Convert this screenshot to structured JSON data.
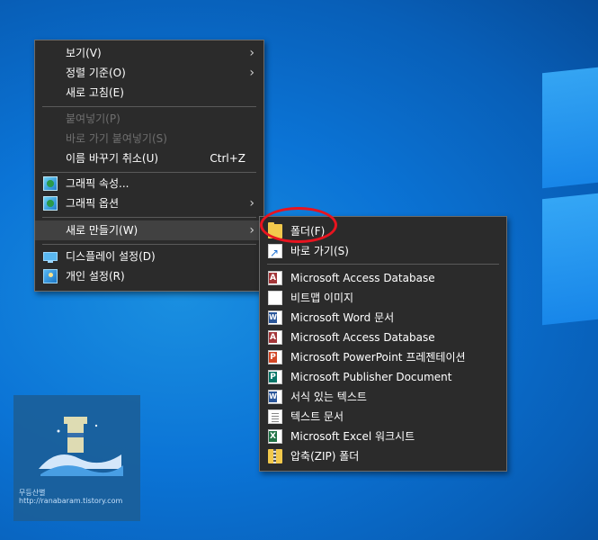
{
  "main_menu": {
    "items": [
      {
        "label": "보기(V)",
        "submenu": true
      },
      {
        "label": "정렬 기준(O)",
        "submenu": true
      },
      {
        "label": "새로 고침(E)"
      },
      {
        "label": "붙여넣기(P)",
        "disabled": true
      },
      {
        "label": "바로 가기 붙여넣기(S)",
        "disabled": true
      },
      {
        "label": "이름 바꾸기 취소(U)",
        "shortcut": "Ctrl+Z"
      },
      {
        "label": "그래픽 속성...",
        "icon": "graphics-icon"
      },
      {
        "label": "그래픽 옵션",
        "icon": "graphics-icon",
        "submenu": true
      },
      {
        "label": "새로 만들기(W)",
        "submenu": true,
        "highlighted": true
      },
      {
        "label": "디스플레이 설정(D)",
        "icon": "display-icon"
      },
      {
        "label": "개인 설정(R)",
        "icon": "personalize-icon"
      }
    ]
  },
  "submenu_new": {
    "items": [
      {
        "label": "폴더(F)",
        "icon": "folder-icon"
      },
      {
        "label": "바로 가기(S)",
        "icon": "shortcut-icon"
      },
      {
        "label": "Microsoft Access Database",
        "icon": "access-icon"
      },
      {
        "label": "비트맵 이미지",
        "icon": "bitmap-icon"
      },
      {
        "label": "Microsoft Word 문서",
        "icon": "word-icon"
      },
      {
        "label": "Microsoft Access Database",
        "icon": "access-icon"
      },
      {
        "label": "Microsoft PowerPoint 프레젠테이션",
        "icon": "powerpoint-icon"
      },
      {
        "label": "Microsoft Publisher Document",
        "icon": "publisher-icon"
      },
      {
        "label": "서식 있는 텍스트",
        "icon": "rich-text-icon"
      },
      {
        "label": "텍스트 문서",
        "icon": "text-document-icon"
      },
      {
        "label": "Microsoft Excel 워크시트",
        "icon": "excel-icon"
      },
      {
        "label": "압축(ZIP) 폴더",
        "icon": "zip-folder-icon"
      }
    ]
  },
  "watermark": {
    "line1": "무등산별",
    "line2": "http://ranabaram.tistory.com"
  },
  "colors": {
    "menu_bg": "#2b2b2b",
    "menu_highlight": "#414141",
    "annotation": "#e8141f",
    "desktop": "#0b74d6"
  }
}
